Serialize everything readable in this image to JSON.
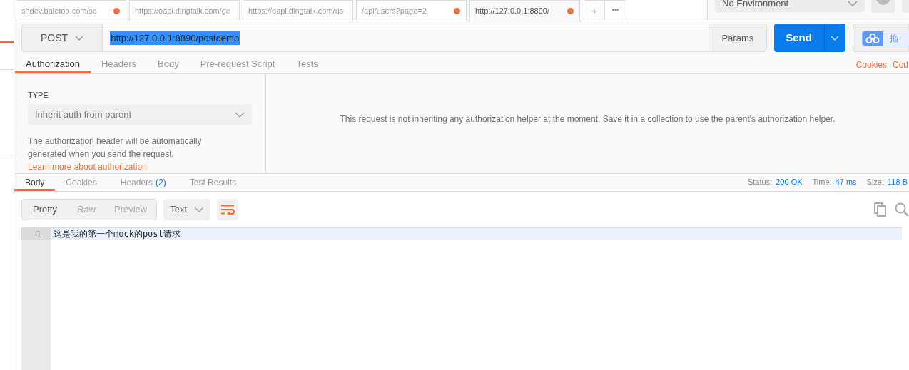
{
  "request_tabs": [
    {
      "label": "shdev.baletoo.com/sc",
      "unsaved": true,
      "selected": false
    },
    {
      "label": "https://oapi.dingtalk.com/ge",
      "unsaved": false,
      "selected": false
    },
    {
      "label": "https://oapi.dingtalk.com/us",
      "unsaved": false,
      "selected": false
    },
    {
      "label": "/api/users?page=2",
      "unsaved": true,
      "selected": false
    },
    {
      "label": "http://127.0.0.1:8890/",
      "unsaved": true,
      "selected": true
    }
  ],
  "new_tab": "+",
  "more_tabs": "•••",
  "environment": {
    "value": "No Environment"
  },
  "request": {
    "method": "POST",
    "url": "http://127.0.0.1:8890/postdemo",
    "url_selected": true,
    "params": "Params",
    "send": "Send"
  },
  "floating_widget": {
    "label": "拖"
  },
  "request_sections": [
    {
      "label": "Authorization",
      "selected": true
    },
    {
      "label": "Headers",
      "selected": false
    },
    {
      "label": "Body",
      "selected": false
    },
    {
      "label": "Pre-request Script",
      "selected": false
    },
    {
      "label": "Tests",
      "selected": false
    }
  ],
  "request_links": [
    "Cookies",
    "Cod"
  ],
  "authorization": {
    "type_label": "TYPE",
    "type_value": "Inherit auth from parent",
    "help": "The authorization header will be automatically generated when you send the request.",
    "help_link": "Learn more about authorization",
    "message": "This request is not inheriting any authorization helper at the moment. Save it in a collection to use the parent's authorization helper."
  },
  "response_tabs": [
    {
      "label": "Body",
      "selected": true
    },
    {
      "label": "Cookies",
      "selected": false
    },
    {
      "label": "Headers",
      "count": "(2)",
      "selected": false
    },
    {
      "label": "Test Results",
      "selected": false
    }
  ],
  "response_meta": [
    {
      "label": "Status:",
      "value": "200 OK"
    },
    {
      "label": "Time:",
      "value": "47 ms"
    },
    {
      "label": "Size:",
      "value": "118 B"
    }
  ],
  "view_modes": [
    {
      "label": "Pretty",
      "selected": true
    },
    {
      "label": "Raw",
      "selected": false
    },
    {
      "label": "Preview",
      "selected": false
    }
  ],
  "format": "Text",
  "wrap_lines": true,
  "editor": {
    "lines": [
      {
        "number": "1",
        "text": "这是我的第一个mock的post请求"
      }
    ]
  }
}
